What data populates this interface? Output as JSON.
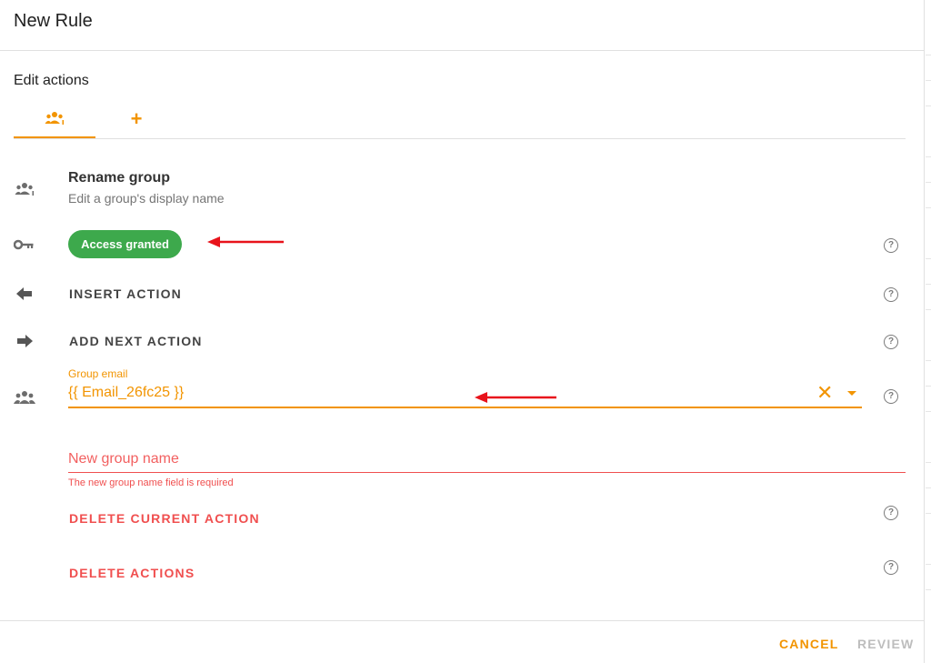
{
  "dialog": {
    "title": "New Rule",
    "section_title": "Edit actions"
  },
  "tabs": [
    {
      "icon": "group-info-icon",
      "active": true
    },
    {
      "icon": "plus-icon",
      "label": "+"
    }
  ],
  "action": {
    "icon": "group-info-icon",
    "title": "Rename group",
    "subtitle": "Edit a group's display name"
  },
  "access": {
    "icon": "key-icon",
    "badge": "Access granted",
    "badge_color": "#3da94c"
  },
  "insert_action": {
    "icon": "arrow-left-icon",
    "label": "INSERT ACTION"
  },
  "add_next_action": {
    "icon": "arrow-right-icon",
    "label": "ADD NEXT ACTION"
  },
  "group_email": {
    "icon": "group-icon",
    "label": "Group email",
    "value": "{{ Email_26fc25 }}"
  },
  "new_group_name": {
    "placeholder": "New group name",
    "error": "The new group name field is required"
  },
  "delete_current_action": {
    "label": "DELETE CURRENT ACTION"
  },
  "delete_actions": {
    "label": "DELETE ACTIONS"
  },
  "footer": {
    "cancel_label": "CANCEL",
    "review_label": "REVIEW"
  },
  "help": {
    "glyph": "?"
  },
  "colors": {
    "accent": "#f29400",
    "danger": "#f04f4f",
    "annotation_arrow": "#e8131b"
  }
}
